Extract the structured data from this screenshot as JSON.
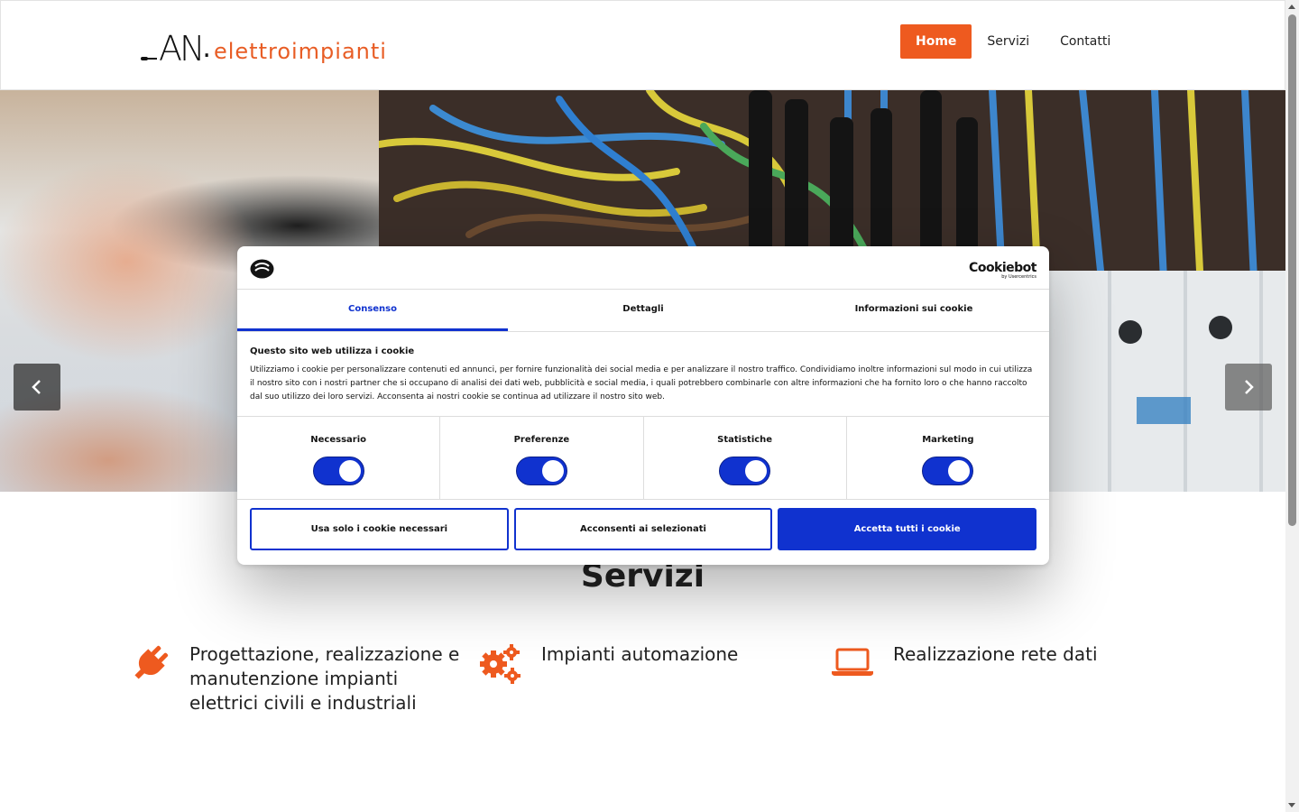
{
  "logo": {
    "prefix": "AN",
    "dot": ".",
    "suffix": "elettroimpianti"
  },
  "nav": [
    {
      "label": "Home",
      "active": true
    },
    {
      "label": "Servizi",
      "active": false
    },
    {
      "label": "Contatti",
      "active": false
    }
  ],
  "carousel": {
    "prev_icon": "chevron-left-icon",
    "next_icon": "chevron-right-icon"
  },
  "cookie": {
    "brand": "Cookiebot",
    "brand_sub": "by Usercentrics",
    "tabs": [
      "Consenso",
      "Dettagli",
      "Informazioni sui cookie"
    ],
    "active_tab": "Consenso",
    "title": "Questo sito web utilizza i cookie",
    "text": "Utilizziamo i cookie per personalizzare contenuti ed annunci, per fornire funzionalità dei social media e per analizzare il nostro traffico. Condividiamo inoltre informazioni sul modo in cui utilizza il nostro sito con i nostri partner che si occupano di analisi dei dati web, pubblicità e social media, i quali potrebbero combinarle con altre informazioni che ha fornito loro o che hanno raccolto dal suo utilizzo dei loro servizi. Acconsenta ai nostri cookie se continua ad utilizzare il nostro sito web.",
    "categories": [
      {
        "label": "Necessario",
        "enabled": true
      },
      {
        "label": "Preferenze",
        "enabled": true
      },
      {
        "label": "Statistiche",
        "enabled": true
      },
      {
        "label": "Marketing",
        "enabled": true
      }
    ],
    "buttons": {
      "necessary": "Usa solo i cookie necessari",
      "selected": "Acconsenti ai selezionati",
      "all": "Accetta tutti i cookie"
    }
  },
  "services": {
    "title": "Servizi",
    "items": [
      {
        "icon": "plug-icon",
        "text": "Progettazione, realizzazione e manutenzione impianti elettrici civili e industriali"
      },
      {
        "icon": "gears-icon",
        "text": "Impianti automazione"
      },
      {
        "icon": "laptop-icon",
        "text": "Realizzazione rete dati"
      }
    ]
  },
  "colors": {
    "accent": "#ee5a1f",
    "cookie_blue": "#1032cf",
    "text": "#222222"
  }
}
